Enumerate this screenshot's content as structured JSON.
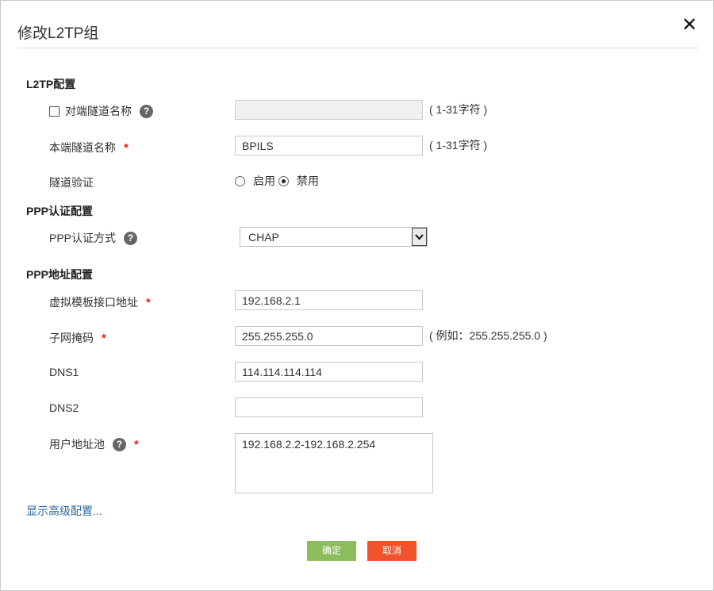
{
  "dialog": {
    "title": "修改L2TP组",
    "close_icon": "close-icon"
  },
  "sections": {
    "l2tp": "L2TP配置",
    "ppp_auth": "PPP认证配置",
    "ppp_addr": "PPP地址配置"
  },
  "fields": {
    "peer_tunnel_name": {
      "label": "对端隧道名称",
      "value": "",
      "hint": "( 1-31字符 )",
      "checked": false
    },
    "local_tunnel_name": {
      "label": "本端隧道名称",
      "value": "BPILS",
      "hint": "( 1-31字符 )"
    },
    "tunnel_auth": {
      "label": "隧道验证",
      "option_on": "启用",
      "option_off": "禁用",
      "selected": "禁用"
    },
    "ppp_auth_method": {
      "label": "PPP认证方式",
      "value": "CHAP"
    },
    "virtual_template_ip": {
      "label": "虚拟模板接口地址",
      "value": "192.168.2.1"
    },
    "subnet_mask": {
      "label": "子网掩码",
      "value": "255.255.255.0",
      "hint": "( 例如：255.255.255.0 )"
    },
    "dns1": {
      "label": "DNS1",
      "value": "114.114.114.114"
    },
    "dns2": {
      "label": "DNS2",
      "value": ""
    },
    "user_pool": {
      "label": "用户地址池",
      "value": "192.168.2.2-192.168.2.254"
    }
  },
  "required_mark": "*",
  "help_mark": "?",
  "advanced_link": "显示高级配置...",
  "buttons": {
    "ok": "确定",
    "cancel": "取消"
  },
  "colors": {
    "ok": "#8cbc5c",
    "cancel": "#f0522c",
    "link": "#2c6aa0",
    "required": "#e02020"
  }
}
